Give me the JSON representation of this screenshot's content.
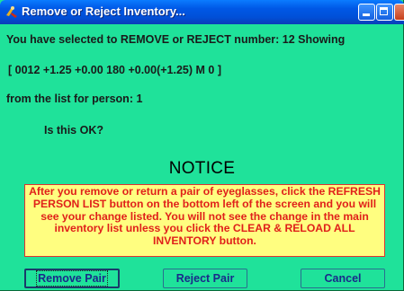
{
  "window": {
    "title": "Remove or Reject Inventory..."
  },
  "message": {
    "line1": "You have selected to REMOVE or REJECT number:  12 Showing",
    "line2": "[ 0012 +1.25 +0.00 180 +0.00(+1.25)    M  0 ]",
    "line3": "from the list for person: 1",
    "line4": "Is this OK?"
  },
  "notice": {
    "title": "NOTICE",
    "body": "After you remove or return a pair of eyeglasses, click the REFRESH PERSON LIST button on the bottom left of the screen and you will see your change listed. You will not see the change in the main inventory list unless you click the CLEAR & RELOAD ALL INVENTORY button."
  },
  "buttons": {
    "remove": "Remove Pair",
    "reject": "Reject Pair",
    "cancel": "Cancel"
  }
}
